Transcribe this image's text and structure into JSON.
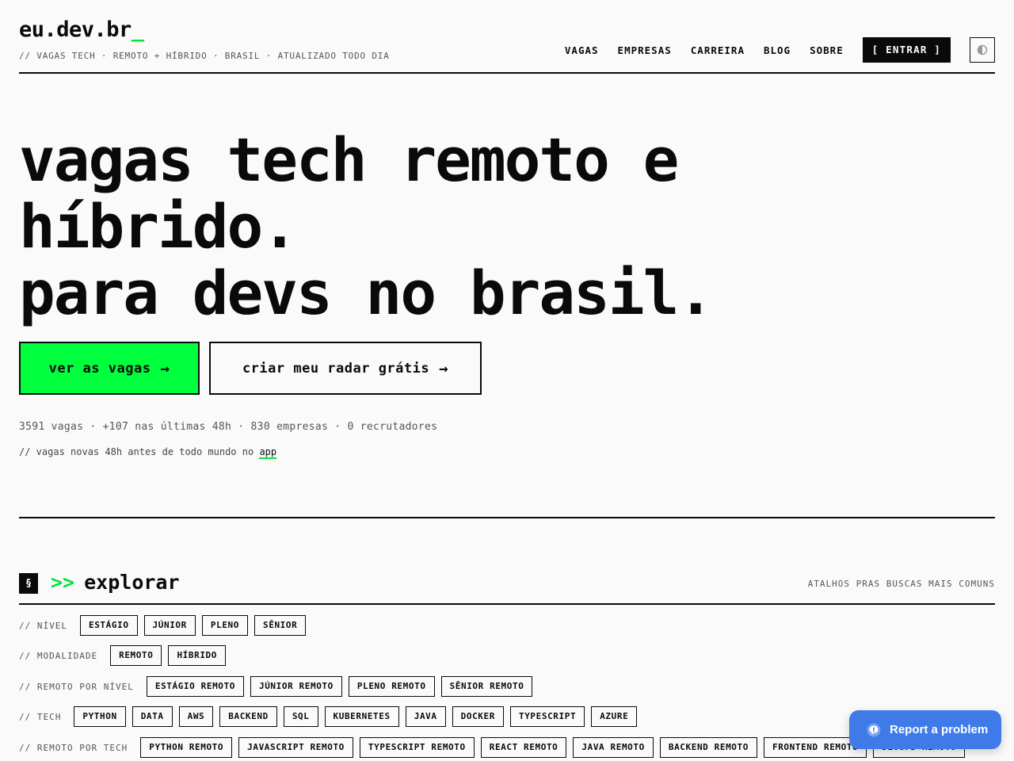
{
  "header": {
    "logo": "eu.dev.br",
    "logo_cursor": "_",
    "tagline": "// VAGAS TECH · REMOTO + HÍBRIDO · BRASIL · ATUALIZADO TODO DIA",
    "nav": [
      "VAGAS",
      "EMPRESAS",
      "CARREIRA",
      "BLOG",
      "SOBRE"
    ],
    "login_label": "[ ENTRAR ]",
    "theme_icon": "contrast-icon"
  },
  "hero": {
    "title_lines": [
      "vagas tech remoto e",
      "híbrido.",
      "para devs no brasil."
    ],
    "cta_primary": "ver as vagas",
    "cta_secondary": "criar meu radar grátis",
    "cta_arrow": "→",
    "stats": "3591 vagas · +107 nas últimas 48h · 830 empresas · 0 recrutadores",
    "note_prefix": "// vagas novas 48h antes de todo mundo no",
    "note_link": "app"
  },
  "explore": {
    "badge": "§",
    "prompt": ">>",
    "title": "explorar",
    "aside": "ATALHOS PRAS BUSCAS MAIS COMUNS",
    "rows": [
      {
        "label": "// NÍVEL",
        "chips": [
          "ESTÁGIO",
          "JÚNIOR",
          "PLENO",
          "SÊNIOR"
        ]
      },
      {
        "label": "// MODALIDADE",
        "chips": [
          "REMOTO",
          "HÍBRIDO"
        ]
      },
      {
        "label": "// REMOTO POR NÍVEL",
        "chips": [
          "ESTÁGIO REMOTO",
          "JÚNIOR REMOTO",
          "PLENO REMOTO",
          "SÊNIOR REMOTO"
        ]
      },
      {
        "label": "// TECH",
        "chips": [
          "PYTHON",
          "DATA",
          "AWS",
          "BACKEND",
          "SQL",
          "KUBERNETES",
          "JAVA",
          "DOCKER",
          "TYPESCRIPT",
          "AZURE"
        ]
      },
      {
        "label": "// REMOTO POR TECH",
        "chips": [
          "PYTHON REMOTO",
          "JAVASCRIPT REMOTO",
          "TYPESCRIPT REMOTO",
          "REACT REMOTO",
          "JAVA REMOTO",
          "BACKEND REMOTO",
          "FRONTEND REMOTO",
          "DEVOPS REMOTO"
        ]
      }
    ]
  },
  "report": {
    "label": "Report a problem",
    "icon": "report-icon"
  },
  "colors": {
    "accent": "#00ff3c",
    "ink": "#0a0a0a",
    "report_blue": "#3f7be8"
  }
}
